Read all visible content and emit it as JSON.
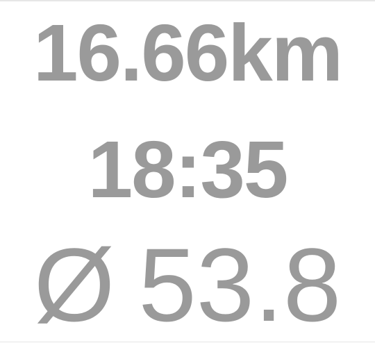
{
  "metrics": {
    "distance": "16.66km",
    "time": "18:35",
    "average_symbol": "Ø",
    "average_value": "53.8"
  },
  "colors": {
    "text": "#9a9a9a",
    "background": "#ffffff",
    "divider": "#e6e6e6"
  }
}
